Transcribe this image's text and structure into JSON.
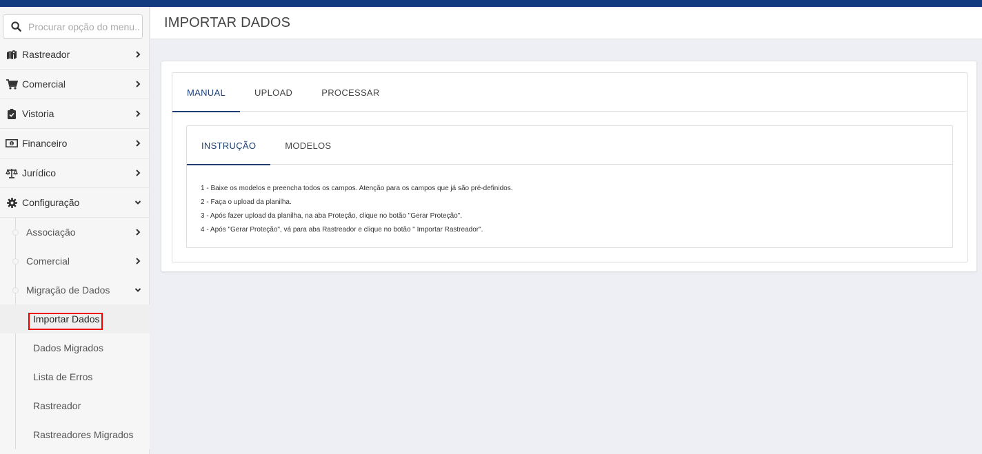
{
  "search": {
    "placeholder": "Procurar opção do menu..."
  },
  "header": {
    "title": "IMPORTAR DADOS"
  },
  "sidebar": {
    "items": [
      {
        "label": "Rastreador",
        "icon": "map-marker-icon"
      },
      {
        "label": "Comercial",
        "icon": "cart-icon"
      },
      {
        "label": "Vistoria",
        "icon": "clipboard-check-icon"
      },
      {
        "label": "Financeiro",
        "icon": "money-icon"
      },
      {
        "label": "Jurídico",
        "icon": "scale-icon"
      },
      {
        "label": "Configuração",
        "icon": "gear-icon"
      }
    ],
    "sub": [
      {
        "label": "Associação"
      },
      {
        "label": "Comercial"
      },
      {
        "label": "Migração de Dados"
      }
    ],
    "subsub": [
      {
        "label": "Importar Dados",
        "active": true
      },
      {
        "label": "Dados Migrados"
      },
      {
        "label": "Lista de Erros"
      },
      {
        "label": "Rastreador"
      },
      {
        "label": "Rastreadores Migrados"
      }
    ]
  },
  "main": {
    "tabs": [
      {
        "label": "MANUAL",
        "active": true
      },
      {
        "label": "UPLOAD"
      },
      {
        "label": "PROCESSAR"
      }
    ],
    "subtabs": [
      {
        "label": "INSTRUÇÃO",
        "active": true
      },
      {
        "label": "MODELOS"
      }
    ],
    "instructions": [
      "1 - Baixe os modelos e preencha todos os campos. Atenção para os campos que já são pré-definidos.",
      "2 - Faça o upload da planilha.",
      "3 - Após fazer upload da planilha, na aba Proteção, clique no botão \"Gerar Proteção\".",
      "4 - Após \"Gerar Proteção\", vá para aba Rastreador e clique no botão \" Importar Rastreador\"."
    ]
  },
  "colors": {
    "topbar": "#143b7f",
    "accent": "#1f3f75",
    "highlight": "#e00000"
  }
}
